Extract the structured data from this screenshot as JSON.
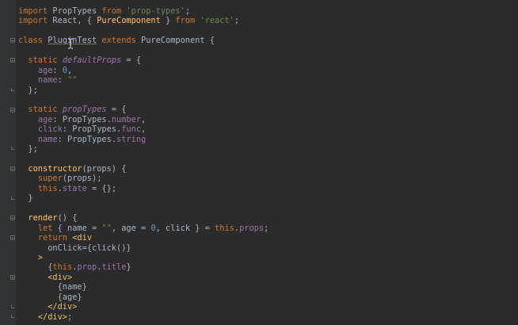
{
  "editor": {
    "theme_colors": {
      "background": "#2b2b2b",
      "gutter": "#313335",
      "keyword": "#cc7832",
      "string": "#6a8759",
      "number": "#6897bb",
      "property": "#9876aa",
      "function": "#ffc66d",
      "tag": "#e8bf6a",
      "default": "#a9b7c6"
    },
    "lines": [
      {
        "tokens": [
          [
            "kw",
            "import"
          ],
          [
            "def",
            " PropTypes "
          ],
          [
            "kw",
            "from"
          ],
          [
            "def",
            " "
          ],
          [
            "str",
            "'prop-types'"
          ],
          [
            "def",
            ";"
          ]
        ]
      },
      {
        "tokens": [
          [
            "kw",
            "import"
          ],
          [
            "def",
            " React, { "
          ],
          [
            "fn",
            "PureComponent"
          ],
          [
            "def",
            " } "
          ],
          [
            "kw",
            "from"
          ],
          [
            "def",
            " "
          ],
          [
            "str",
            "'react'"
          ],
          [
            "def",
            ";"
          ]
        ]
      },
      {
        "tokens": []
      },
      {
        "tokens": [
          [
            "kw",
            "class"
          ],
          [
            "def",
            " "
          ],
          [
            "cls",
            "PluginTest"
          ],
          [
            "def",
            " "
          ],
          [
            "kw",
            "extends"
          ],
          [
            "def",
            " PureComponent {"
          ]
        ],
        "fold": "start"
      },
      {
        "tokens": []
      },
      {
        "tokens": [
          [
            "def",
            "  "
          ],
          [
            "kw",
            "static"
          ],
          [
            "def",
            " "
          ],
          [
            "ital",
            "defaultProps"
          ],
          [
            "def",
            " = {"
          ]
        ],
        "fold": "start"
      },
      {
        "tokens": [
          [
            "def",
            "    "
          ],
          [
            "prop",
            "age"
          ],
          [
            "def",
            ": "
          ],
          [
            "num",
            "0"
          ],
          [
            "def",
            ","
          ]
        ]
      },
      {
        "tokens": [
          [
            "def",
            "    "
          ],
          [
            "prop",
            "name"
          ],
          [
            "def",
            ": "
          ],
          [
            "str",
            "\"\""
          ]
        ]
      },
      {
        "tokens": [
          [
            "def",
            "  };"
          ]
        ],
        "fold": "end"
      },
      {
        "tokens": []
      },
      {
        "tokens": [
          [
            "def",
            "  "
          ],
          [
            "kw",
            "static"
          ],
          [
            "def",
            " "
          ],
          [
            "ital",
            "propTypes"
          ],
          [
            "def",
            " = {"
          ]
        ],
        "fold": "start"
      },
      {
        "tokens": [
          [
            "def",
            "    "
          ],
          [
            "prop",
            "age"
          ],
          [
            "def",
            ": PropTypes."
          ],
          [
            "prop",
            "number"
          ],
          [
            "def",
            ","
          ]
        ]
      },
      {
        "tokens": [
          [
            "def",
            "    "
          ],
          [
            "prop",
            "click"
          ],
          [
            "def",
            ": PropTypes."
          ],
          [
            "prop",
            "func"
          ],
          [
            "def",
            ","
          ]
        ]
      },
      {
        "tokens": [
          [
            "def",
            "    "
          ],
          [
            "prop",
            "name"
          ],
          [
            "def",
            ": PropTypes."
          ],
          [
            "prop",
            "string"
          ]
        ]
      },
      {
        "tokens": [
          [
            "def",
            "  };"
          ]
        ],
        "fold": "end"
      },
      {
        "tokens": []
      },
      {
        "tokens": [
          [
            "def",
            "  "
          ],
          [
            "fn",
            "constructor"
          ],
          [
            "def",
            "(props) {"
          ]
        ],
        "fold": "start"
      },
      {
        "tokens": [
          [
            "def",
            "    "
          ],
          [
            "kw",
            "super"
          ],
          [
            "def",
            "(props);"
          ]
        ]
      },
      {
        "tokens": [
          [
            "def",
            "    "
          ],
          [
            "kw",
            "this"
          ],
          [
            "def",
            "."
          ],
          [
            "prop",
            "state"
          ],
          [
            "def",
            " = {};"
          ]
        ]
      },
      {
        "tokens": [
          [
            "def",
            "  }"
          ]
        ],
        "fold": "end"
      },
      {
        "tokens": []
      },
      {
        "tokens": [
          [
            "def",
            "  "
          ],
          [
            "fn",
            "render"
          ],
          [
            "def",
            "() {"
          ]
        ],
        "fold": "start"
      },
      {
        "tokens": [
          [
            "def",
            "    "
          ],
          [
            "kw",
            "let"
          ],
          [
            "def",
            " { name = "
          ],
          [
            "str",
            "\"\""
          ],
          [
            "def",
            ", age = "
          ],
          [
            "num",
            "0"
          ],
          [
            "def",
            ", click } = "
          ],
          [
            "kw",
            "this"
          ],
          [
            "def",
            "."
          ],
          [
            "prop",
            "props"
          ],
          [
            "def",
            ";"
          ]
        ]
      },
      {
        "tokens": [
          [
            "def",
            "    "
          ],
          [
            "kw",
            "return"
          ],
          [
            "def",
            " "
          ],
          [
            "tag",
            "<div"
          ]
        ],
        "fold": "start"
      },
      {
        "tokens": [
          [
            "def",
            "      "
          ],
          [
            "def",
            "onClick"
          ],
          [
            "def",
            "="
          ],
          [
            "def",
            "{click()}"
          ]
        ]
      },
      {
        "tokens": [
          [
            "def",
            "    "
          ],
          [
            "tag",
            ">"
          ]
        ]
      },
      {
        "tokens": [
          [
            "def",
            "      {"
          ],
          [
            "kw",
            "this"
          ],
          [
            "def",
            "."
          ],
          [
            "prop",
            "prop"
          ],
          [
            "def",
            "."
          ],
          [
            "prop",
            "title"
          ],
          [
            "def",
            "}"
          ]
        ]
      },
      {
        "tokens": [
          [
            "def",
            "      "
          ],
          [
            "tag",
            "<div>"
          ]
        ],
        "fold": "start"
      },
      {
        "tokens": [
          [
            "def",
            "        {name}"
          ]
        ]
      },
      {
        "tokens": [
          [
            "def",
            "        {age}"
          ]
        ]
      },
      {
        "tokens": [
          [
            "def",
            "      "
          ],
          [
            "tag",
            "</div>"
          ]
        ],
        "fold": "end"
      },
      {
        "tokens": [
          [
            "def",
            "    "
          ],
          [
            "tag",
            "</div>"
          ],
          [
            "def",
            ";"
          ]
        ],
        "fold": "end"
      }
    ]
  }
}
